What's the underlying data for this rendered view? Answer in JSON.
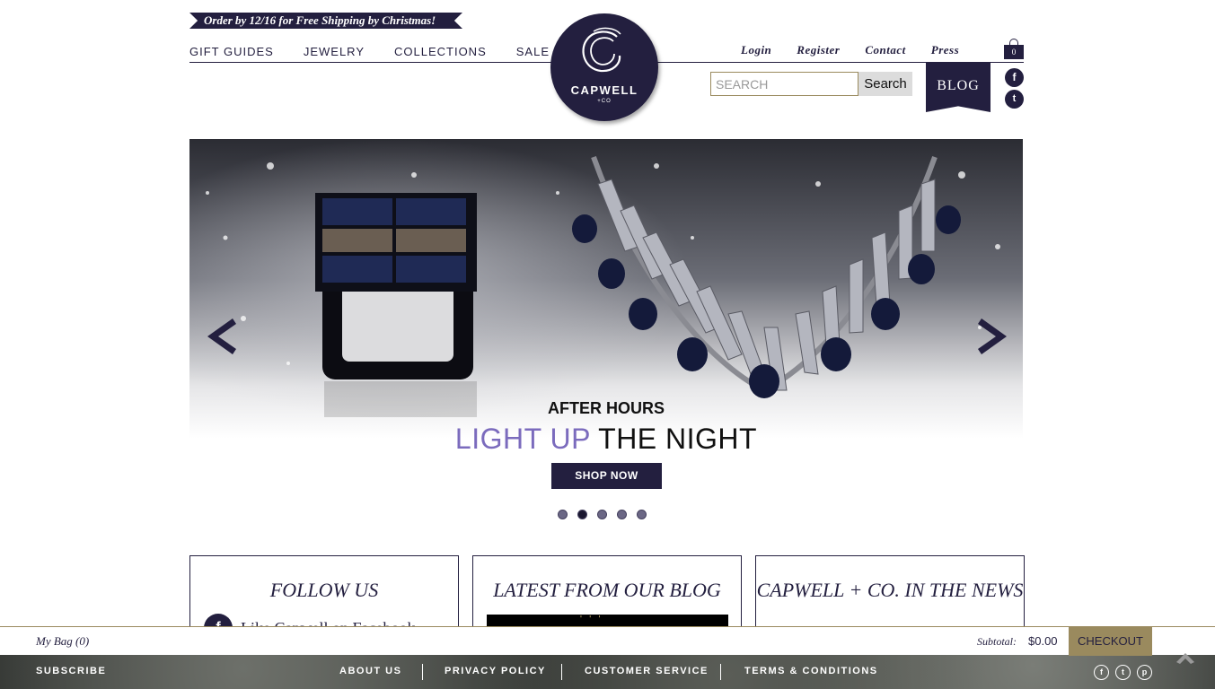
{
  "promo": {
    "text": "Order by 12/16 for Free Shipping by Christmas!"
  },
  "main_nav": {
    "items": [
      {
        "label": "GIFT GUIDES"
      },
      {
        "label": "JEWELRY"
      },
      {
        "label": "COLLECTIONS"
      },
      {
        "label": "SALE"
      }
    ]
  },
  "logo": {
    "name": "CAPWELL",
    "sub": "+CO"
  },
  "util_nav": {
    "items": [
      {
        "label": "Login"
      },
      {
        "label": "Register"
      },
      {
        "label": "Contact"
      },
      {
        "label": "Press"
      }
    ]
  },
  "bag": {
    "count": "0"
  },
  "search": {
    "placeholder": "SEARCH",
    "button_label": "Search"
  },
  "blog": {
    "label": "BLOG"
  },
  "social_header": {
    "facebook_icon": "facebook-icon",
    "twitter_icon": "twitter-icon"
  },
  "hero": {
    "subtitle": "AFTER HOURS",
    "title_accent": "LIGHT UP",
    "title_rest": " THE NIGHT",
    "button_label": "SHOP NOW",
    "active_slide": 2,
    "slide_count": 5
  },
  "cards": [
    {
      "title": "FOLLOW US",
      "peek_text": "Like Capwell on Facebook"
    },
    {
      "title": "LATEST FROM OUR BLOG"
    },
    {
      "title": "CAPWELL + CO. IN THE NEWS"
    }
  ],
  "bag_bar": {
    "my_bag": "My Bag (0)",
    "subtotal_label": "Subtotal:",
    "subtotal_value": "$0.00",
    "checkout_label": "CHECKOUT"
  },
  "footer": {
    "subscribe": "SUBSCRIBE",
    "links": [
      {
        "label": "ABOUT US"
      },
      {
        "label": "PRIVACY POLICY"
      },
      {
        "label": "CUSTOMER SERVICE"
      },
      {
        "label": "TERMS & CONDITIONS"
      }
    ],
    "social": [
      "facebook-icon",
      "twitter-icon",
      "pinterest-icon"
    ]
  },
  "colors": {
    "brand": "#231f3f",
    "accent": "#7b6bbd",
    "gold": "#9a8a5e"
  }
}
